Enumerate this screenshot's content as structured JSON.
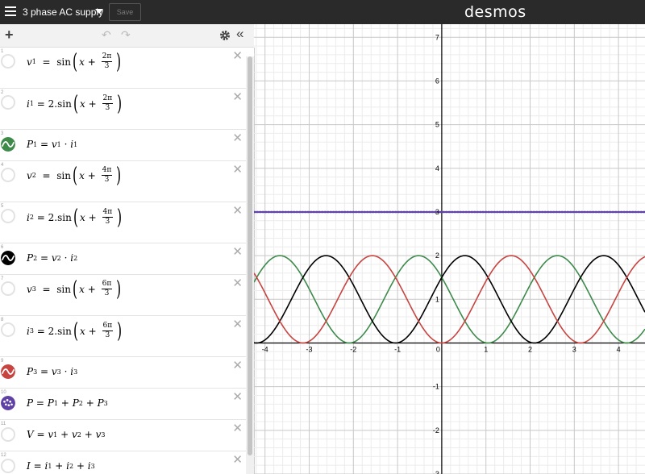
{
  "topbar": {
    "title": "3 phase AC supply",
    "save_label": "Save",
    "brand": "desmos"
  },
  "toolbar": {
    "add": "+",
    "undo": "↶",
    "redo": "↷",
    "settings": "gear",
    "collapse": "«"
  },
  "expressions": [
    {
      "num": "1",
      "icon": "hidden",
      "color": ""
    },
    {
      "num": "2",
      "icon": "hidden",
      "color": ""
    },
    {
      "num": "3",
      "icon": "wave",
      "color": "#3d8a4b"
    },
    {
      "num": "4",
      "icon": "hidden",
      "color": ""
    },
    {
      "num": "5",
      "icon": "hidden",
      "color": ""
    },
    {
      "num": "6",
      "icon": "wave",
      "color": "#000000"
    },
    {
      "num": "7",
      "icon": "hidden",
      "color": ""
    },
    {
      "num": "8",
      "icon": "hidden",
      "color": ""
    },
    {
      "num": "9",
      "icon": "wave",
      "color": "#c74440"
    },
    {
      "num": "10",
      "icon": "dots",
      "color": "#6042a6"
    },
    {
      "num": "11",
      "icon": "hidden",
      "color": ""
    },
    {
      "num": "12",
      "icon": "hidden",
      "color": ""
    }
  ],
  "math": {
    "v": "v",
    "i": "i",
    "P": "P",
    "V": "V",
    "I": "I",
    "x": "x",
    "sin": "sin",
    "two": "2.",
    "eq": "=",
    "plus": "+",
    "dot": "·",
    "s1": "1",
    "s2": "2",
    "s3": "3",
    "pi2": "2π",
    "pi4": "4π",
    "pi6": "6π",
    "den": "3"
  },
  "chart_data": {
    "type": "line",
    "xlim": [
      -4.25,
      4.6
    ],
    "ylim": [
      -3,
      7.3
    ],
    "x_ticks": [
      "-4",
      "-3",
      "-2",
      "-1",
      "0",
      "1",
      "2",
      "3",
      "4"
    ],
    "y_ticks": [
      "-3",
      "-2",
      "-1",
      "1",
      "2",
      "3",
      "4",
      "5",
      "6",
      "7"
    ],
    "grid": true,
    "series": [
      {
        "expr": "P1 = 2 sin^2(x + 2π/3)",
        "phase": "2π/3",
        "amplitude": 2,
        "color": "#3d8a4b"
      },
      {
        "expr": "P2 = 2 sin^2(x + 4π/3)",
        "phase": "4π/3",
        "amplitude": 2,
        "color": "#000000"
      },
      {
        "expr": "P3 = 2 sin^2(x + 2π)",
        "phase": "6π/3",
        "amplitude": 2,
        "color": "#c74440"
      },
      {
        "expr": "P = P1 + P2 + P3",
        "constant": 3,
        "color": "#6042a6",
        "style": "dotted"
      }
    ]
  }
}
